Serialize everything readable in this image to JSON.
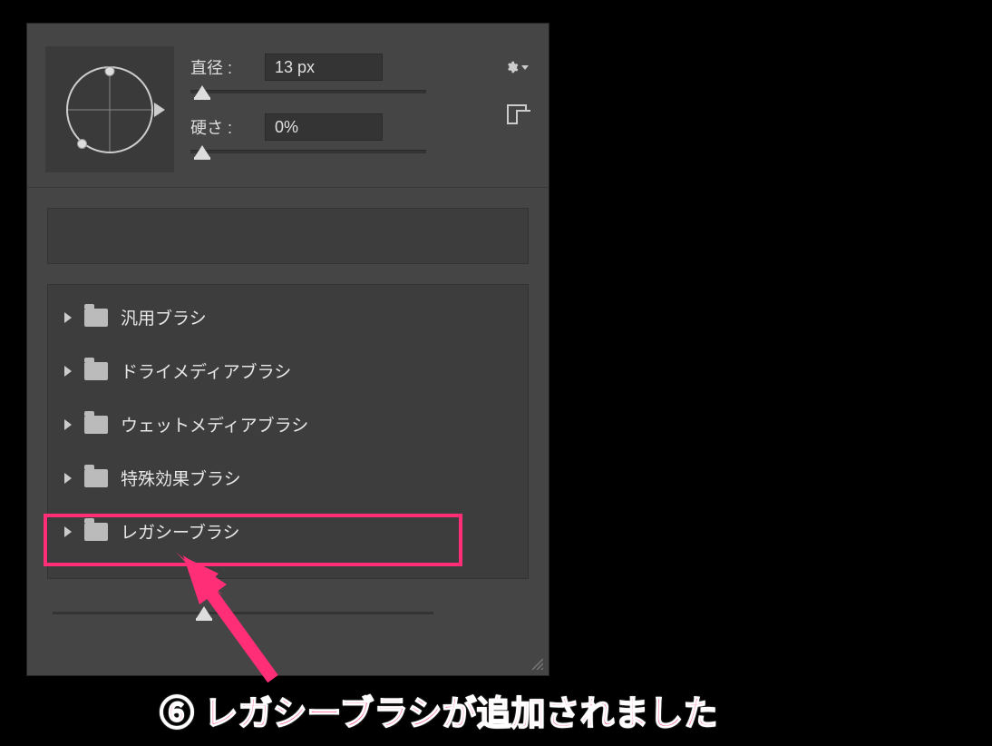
{
  "size": {
    "label": "直径 :",
    "value": "13 px"
  },
  "hardness": {
    "label": "硬さ :",
    "value": "0%"
  },
  "folders": [
    {
      "label": "汎用ブラシ"
    },
    {
      "label": "ドライメディアブラシ"
    },
    {
      "label": "ウェットメディアブラシ"
    },
    {
      "label": "特殊効果ブラシ"
    },
    {
      "label": "レガシーブラシ"
    }
  ],
  "caption": "⑥ レガシーブラシが追加されました",
  "colors": {
    "accent": "#ff2e77"
  }
}
